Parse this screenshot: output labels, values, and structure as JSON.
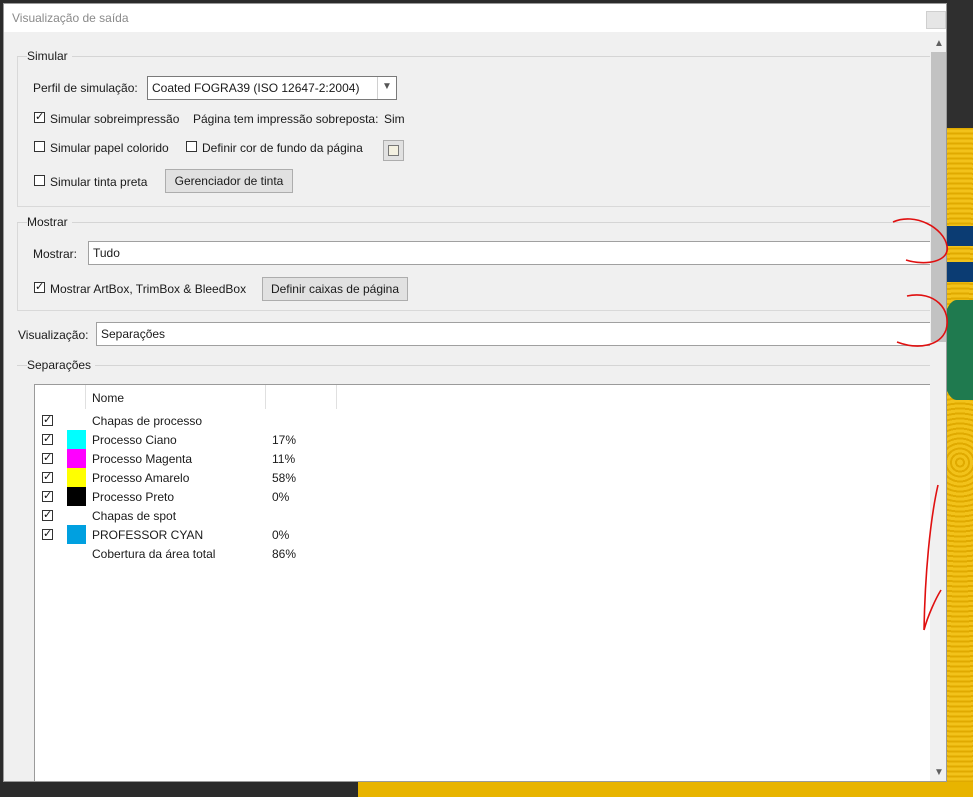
{
  "window": {
    "title": "Visualização de saída"
  },
  "simular": {
    "group_label": "Simular",
    "perfil_label": "Perfil de simulação:",
    "perfil_value": "Coated FOGRA39 (ISO 12647-2:2004)",
    "sobreimpressao_label": "Simular sobreimpressão",
    "sobreimpressao_checked": true,
    "pagina_sobreposta_label": "Página tem impressão sobreposta:",
    "pagina_sobreposta_value": "Sim",
    "papel_colorido_label": "Simular papel colorido",
    "definir_cor_label": "Definir cor de fundo da página",
    "tinta_preta_label": "Simular tinta preta",
    "gerenciador_button": "Gerenciador de tinta"
  },
  "mostrar": {
    "group_label": "Mostrar",
    "mostrar_label": "Mostrar:",
    "mostrar_value": "Tudo",
    "boxes_label": "Mostrar ArtBox, TrimBox & BleedBox",
    "boxes_checked": true,
    "definir_caixas_button": "Definir caixas de página"
  },
  "visualizacao": {
    "label": "Visualização:",
    "value": "Separações"
  },
  "separacoes": {
    "group_label": "Separações",
    "column_name": "Nome",
    "rows": [
      {
        "checked": true,
        "color": "",
        "name": "Chapas de processo",
        "pct": ""
      },
      {
        "checked": true,
        "color": "#00ffff",
        "name": "Processo Ciano",
        "pct": "17%"
      },
      {
        "checked": true,
        "color": "#ff00ff",
        "name": "Processo Magenta",
        "pct": "11%"
      },
      {
        "checked": true,
        "color": "#ffff00",
        "name": "Processo Amarelo",
        "pct": "58%"
      },
      {
        "checked": true,
        "color": "#000000",
        "name": "Processo Preto",
        "pct": "0%"
      },
      {
        "checked": true,
        "color": "",
        "name": "Chapas de spot",
        "pct": ""
      },
      {
        "checked": true,
        "color": "#00a0e0",
        "name": "PROFESSOR CYAN",
        "pct": "0%"
      },
      {
        "checked": null,
        "color": "",
        "name": "Cobertura da área total",
        "pct": "86%"
      }
    ]
  },
  "colors": {
    "annotation": "#e01010",
    "dialog_bg": "#f0f0f0"
  }
}
